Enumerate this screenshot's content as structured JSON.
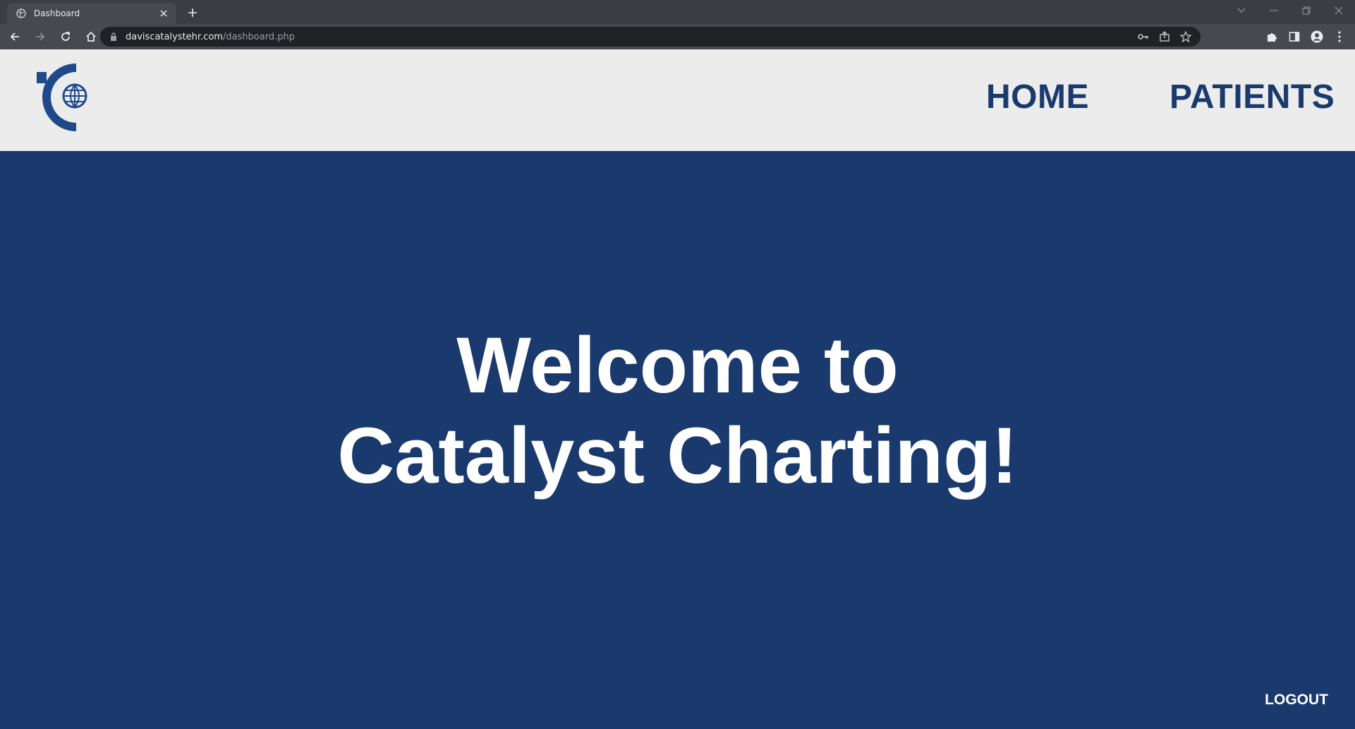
{
  "browser": {
    "tab_title": "Dashboard",
    "url_domain": "daviscatalystehr.com",
    "url_path": "/dashboard.php",
    "icons": [
      "globe-icon",
      "close-icon",
      "plus-icon",
      "back-icon",
      "forward-icon",
      "reload-icon",
      "home-icon",
      "lock-icon",
      "key-icon",
      "share-icon",
      "star-icon",
      "puzzle-icon",
      "side-panel-icon",
      "profile-icon",
      "more-icon",
      "minimize-icon",
      "restore-icon"
    ]
  },
  "header": {
    "nav": {
      "home_label": "HOME",
      "patients_label": "PATIENTS"
    }
  },
  "hero": {
    "line1": "Welcome to",
    "line2": "Catalyst Charting!",
    "logout_label": "LOGOUT"
  },
  "colors": {
    "brand_blue": "#1a3a6e",
    "header_bg": "#ececec",
    "text_white": "#ffffff"
  }
}
